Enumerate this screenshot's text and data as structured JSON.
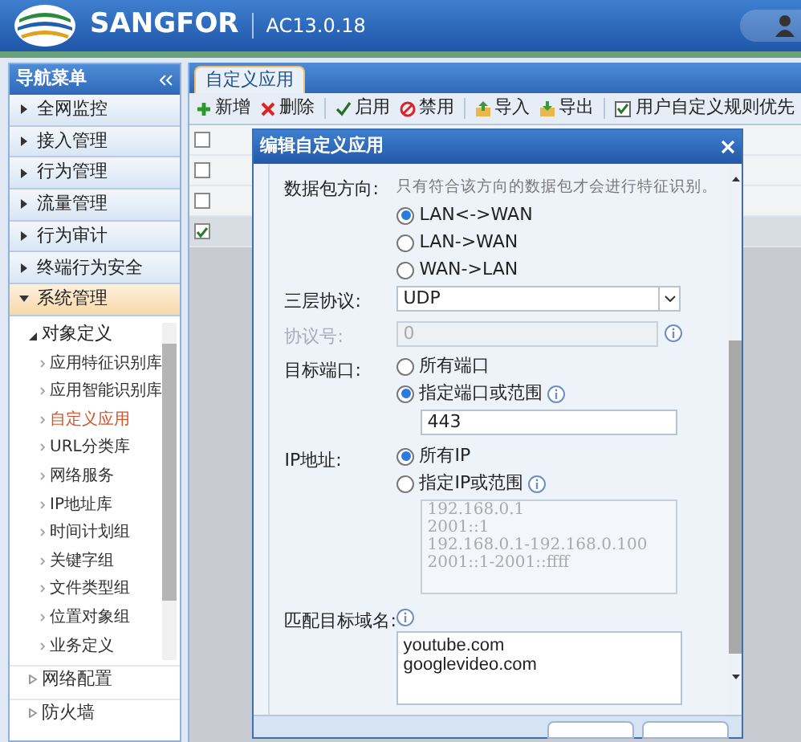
{
  "header": {
    "brand": "SANGFOR",
    "version": "AC13.0.18"
  },
  "nav": {
    "title": "导航菜单",
    "sections": [
      {
        "label": "全网监控",
        "expanded": false
      },
      {
        "label": "接入管理",
        "expanded": false
      },
      {
        "label": "行为管理",
        "expanded": false
      },
      {
        "label": "流量管理",
        "expanded": false
      },
      {
        "label": "行为审计",
        "expanded": false
      },
      {
        "label": "终端行为安全",
        "expanded": false
      },
      {
        "label": "系统管理",
        "expanded": true,
        "children": [
          {
            "label": "对象定义",
            "expanded": true,
            "children": [
              {
                "label": "应用特征识别库",
                "selected": false
              },
              {
                "label": "应用智能识别库",
                "selected": false
              },
              {
                "label": "自定义应用",
                "selected": true
              },
              {
                "label": "URL分类库",
                "selected": false
              },
              {
                "label": "网络服务",
                "selected": false
              },
              {
                "label": "IP地址库",
                "selected": false
              },
              {
                "label": "时间计划组",
                "selected": false
              },
              {
                "label": "关键字组",
                "selected": false
              },
              {
                "label": "文件类型组",
                "selected": false
              },
              {
                "label": "位置对象组",
                "selected": false
              },
              {
                "label": "业务定义",
                "selected": false
              }
            ]
          },
          {
            "label": "网络配置",
            "expanded": false
          },
          {
            "label": "防火墙",
            "expanded": false
          }
        ]
      }
    ]
  },
  "tabs": [
    {
      "label": "自定义应用",
      "selected": true
    }
  ],
  "toolbar": [
    {
      "kind": "add",
      "label": "新增"
    },
    {
      "kind": "delete",
      "label": "删除"
    },
    {
      "kind": "enable",
      "label": "启用"
    },
    {
      "kind": "disable",
      "label": "禁用"
    },
    {
      "kind": "import",
      "label": "导入"
    },
    {
      "kind": "export",
      "label": "导出"
    },
    {
      "kind": "checkbox",
      "label": "用户自定义规则优先",
      "checked": true
    }
  ],
  "table": {
    "rows": [
      {
        "checked": false
      },
      {
        "checked": false
      },
      {
        "checked": false
      },
      {
        "checked": true
      }
    ]
  },
  "dialog": {
    "title": "编辑自定义应用",
    "fields": [
      {
        "kind": "radio",
        "label": "数据包方向:",
        "hint": "只有符合该方向的数据包才会进行特征识别。",
        "options": [
          {
            "label": "LAN<->WAN",
            "selected": true
          },
          {
            "label": "LAN->WAN",
            "selected": false
          },
          {
            "label": "WAN->LAN",
            "selected": false
          }
        ]
      },
      {
        "kind": "select",
        "label": "三层协议:",
        "value": "UDP"
      },
      {
        "kind": "input",
        "label": "协议号:",
        "value": "0",
        "disabled": true
      },
      {
        "kind": "radio",
        "label": "目标端口:",
        "options": [
          {
            "label": "所有端口",
            "selected": false
          },
          {
            "label": "指定端口或范围",
            "selected": true,
            "value": "443"
          }
        ]
      },
      {
        "kind": "radio",
        "label": "IP地址:",
        "options": [
          {
            "label": "所有IP",
            "selected": true
          },
          {
            "label": "指定IP或范围",
            "selected": false,
            "placeholder": [
              "192.168.0.1",
              "2001::1",
              "192.168.0.1-192.168.0.100",
              "2001::1-2001::ffff"
            ]
          }
        ]
      },
      {
        "kind": "textarea",
        "label": "匹配目标域名:",
        "lines": [
          "youtube.com",
          "googlevideo.com"
        ]
      }
    ]
  }
}
